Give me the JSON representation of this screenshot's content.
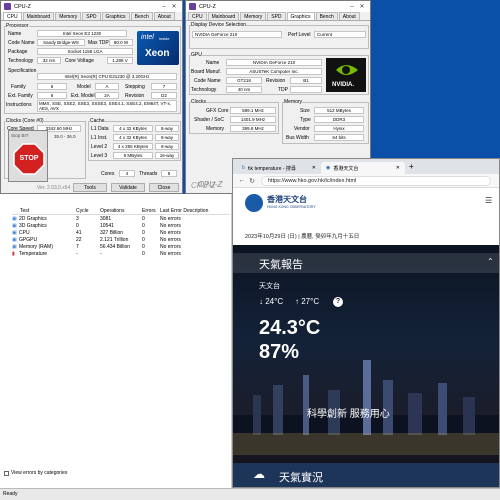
{
  "cpuz": {
    "title": "CPU-Z",
    "tabs": [
      "CPU",
      "Mainboard",
      "Memory",
      "SPD",
      "Graphics",
      "Bench",
      "About"
    ],
    "processor_label": "Processor",
    "name_label": "Name",
    "name": "Intel Xeon E3 1230",
    "codename_label": "Code Name",
    "codename": "Sandy Bridge-WS",
    "maxtdp_label": "Max TDP",
    "maxtdp": "80.0 W",
    "package_label": "Package",
    "package": "Socket 1155 LGA",
    "technology_label": "Technology",
    "technology": "32 nm",
    "voltage_label": "Core Voltage",
    "voltage": "1.288 V",
    "spec_label": "Specification",
    "spec": "Intel(R) Xeon(R) CPU E31230 @ 3.20GHz",
    "family_label": "Family",
    "family": "6",
    "model_label": "Model",
    "model": "A",
    "stepping_label": "Stepping",
    "stepping": "7",
    "extfamily_label": "Ext. Family",
    "extfamily": "6",
    "extmodel_label": "Ext. Model",
    "extmodel": "2A",
    "revision_label": "Revision",
    "revision": "D2",
    "instr_label": "Instructions",
    "instr": "MMX, SSE, SSE2, SSE3, SSSE3, SSE4.1, SSE4.2, EM64T, VT-x, AES, AVX",
    "clocks_label": "Clocks (Core #0)",
    "corespeed_label": "Core Speed",
    "corespeed": "3342.60 MHz",
    "cache_label": "Cache",
    "l1d_label": "L1 Data",
    "l1d": "4 x 32 KBytes",
    "l1d_way": "8-way",
    "l1i_label": "L1 Inst.",
    "l1i": "4 x 32 KBytes",
    "l1i_way": "8-way",
    "l2_label": "Level 2",
    "l2": "4 x 256 KBytes",
    "l2_way": "8-way",
    "l3_label": "Level 3",
    "l3": "8 MBytes",
    "l3_way": "16-way",
    "cores_label": "Cores",
    "cores": "4",
    "threads_label": "Threads",
    "threads": "8",
    "busspeed": "35.0 - 36.0",
    "version": "Ver. 2.03.0.x64",
    "tools_btn": "Tools",
    "validate_btn": "Validate",
    "close_btn": "Close",
    "logo_brand": "intel",
    "logo_sub": "inside",
    "logo_product": "Xeon",
    "stop_label": "STOP",
    "stop_text": "Stop BIT"
  },
  "gpuz": {
    "title": "CPU-Z",
    "tabs": [
      "CPU",
      "Mainboard",
      "Memory",
      "SPD",
      "Graphics",
      "Bench",
      "About"
    ],
    "display_label": "Display Device Selection",
    "device": "NVIDIA GeForce 210",
    "perf_label": "Perf Level",
    "perf": "Current",
    "gpu_label": "GPU",
    "name_label": "Name",
    "name": "NVIDIA GeForce 210",
    "board_label": "Board Manuf.",
    "board": "ASUSTeK Computer Inc.",
    "codename_label": "Code Name",
    "codename": "GT218",
    "revision_label": "Revision",
    "revision": "B1",
    "tech_label": "Technology",
    "tech": "40 nm",
    "tdp_label": "TDP",
    "clocks_label": "Clocks",
    "gfxcore_label": "GFX Core",
    "gfxcore": "589.1 MHz",
    "shader_label": "Shader / SoC",
    "shader": "1401.9 MHz",
    "memclk_label": "Memory",
    "memclk": "399.8 MHz",
    "memory_label": "Memory",
    "size_label": "Size",
    "size": "512 MBytes",
    "type_label": "Type",
    "type": "DDR3",
    "vendor_label": "Vendor",
    "vendor": "Hynix",
    "buswidth_label": "Bus Width",
    "buswidth": "64 bits",
    "nvidia_logo": "NVIDIA.",
    "version": "CPU-Z"
  },
  "burnin": {
    "columns": [
      "Test",
      "Cycle",
      "Operations",
      "Errors",
      "Last Error Description"
    ],
    "rows": [
      {
        "test": "2D Graphics",
        "cycle": "3",
        "ops": "3081",
        "errors": "0",
        "desc": "No errors"
      },
      {
        "test": "3D Graphics",
        "cycle": "0",
        "ops": "10541",
        "errors": "0",
        "desc": "No errors"
      },
      {
        "test": "CPU",
        "cycle": "41",
        "ops": "327 Billion",
        "errors": "0",
        "desc": "No errors"
      },
      {
        "test": "GPGPU",
        "cycle": "22",
        "ops": "2.121 Trillion",
        "errors": "0",
        "desc": "No errors"
      },
      {
        "test": "Memory (RAM)",
        "cycle": "7",
        "ops": "56.434 Billion",
        "errors": "0",
        "desc": "No errors"
      },
      {
        "test": "Temperature",
        "cycle": "-",
        "ops": "-",
        "errors": "0",
        "desc": "No errors"
      }
    ],
    "view_errors_label": "View errors by categories",
    "status": "Ready",
    "cpuz_watermark": "CPU-Z"
  },
  "browser": {
    "tab1": "hk temperature - 搜尋",
    "tab2": "香港天文台",
    "url": "https://www.hko.gov.hk/tc/index.html",
    "org_name": "香港天文台",
    "org_en": "HONG KONG OBSERVATORY",
    "date_line": "2023年10月29日 (日) | 農曆, 癸卯年九月十五日",
    "weather_report": "天氣報告",
    "station": "天文台",
    "low_temp": "↓ 24°C",
    "high_temp": "↑ 27°C",
    "help": "?",
    "current_temp": "24.3°C",
    "humidity": "87%",
    "slogan": "科學創新 服務用心",
    "live_weather": "天氣實況"
  }
}
